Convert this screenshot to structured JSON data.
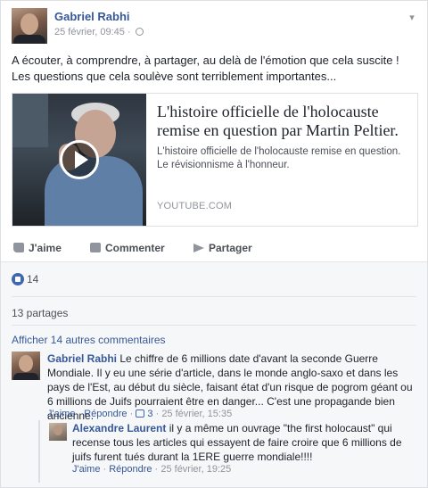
{
  "post": {
    "author": "Gabriel Rabhi",
    "timestamp": "25 février, 09:45 ·",
    "text": "A écouter, à comprendre, à partager, au delà de l'émotion que cela suscite ! Les questions que cela soulève sont terriblement importantes...",
    "link": {
      "title": "L'histoire officielle de l'holocauste remise en question par Martin Peltier.",
      "description": "L'histoire officielle de l'holocauste remise en question. Le révisionnisme à l'honneur.",
      "source": "YOUTUBE.COM"
    }
  },
  "actions": {
    "like": "J'aime",
    "comment": "Commenter",
    "share": "Partager"
  },
  "reactions": {
    "likes_count": "14",
    "shares": "13 partages",
    "more_comments": "Afficher 14 autres commentaires"
  },
  "comments": [
    {
      "author": "Gabriel Rabhi",
      "text": "Le chiffre de 6 millions date d'avant la seconde Guerre Mondiale. Il y eu une série d'article, dans le monde anglo-saxo et dans les pays de l'Est, au début du siècle, faisant état d'un risque de pogrom géant ou 6 millions de Juifs pourraient être en danger... C'est une propagande bien ancienne.",
      "like": "J'aime",
      "reply": "Répondre",
      "likes": "3",
      "time": "25 février, 15:35"
    },
    {
      "author": "Alexandre Laurent",
      "text": "il y a même un ouvrage \"the first holocaust\" qui recense tous les articles qui essayent de faire croire que 6 millions de juifs furent tués durant la 1ERE guerre mondiale!!!!",
      "like": "J'aime",
      "reply": "Répondre",
      "time": "25 février, 19:25"
    }
  ],
  "icons": {
    "avatar": "profile-photo",
    "play": "play-icon",
    "like": "thumbs-up-icon",
    "comment": "comment-icon",
    "share": "share-arrow-icon",
    "globe": "globe-icon",
    "menu": "chevron-down-icon"
  },
  "colors": {
    "link_blue": "#365899",
    "text": "#1d2129",
    "muted": "#90949c",
    "like_blue": "#4267b2"
  }
}
